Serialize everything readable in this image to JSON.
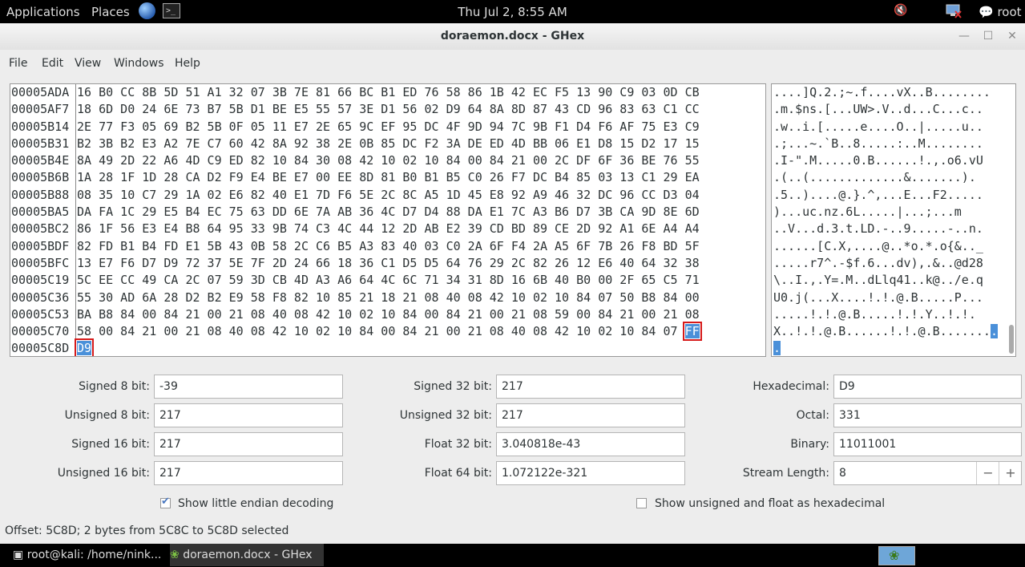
{
  "topbar": {
    "applications": "Applications",
    "places": "Places",
    "clock": "Thu Jul  2,  8:55 AM",
    "user": "root"
  },
  "window": {
    "title": "doraemon.docx - GHex"
  },
  "menu": [
    "File",
    "Edit",
    "View",
    "Windows",
    "Help"
  ],
  "hex": {
    "offsets": [
      "00005ADA",
      "00005AF7",
      "00005B14",
      "00005B31",
      "00005B4E",
      "00005B6B",
      "00005B88",
      "00005BA5",
      "00005BC2",
      "00005BDF",
      "00005BFC",
      "00005C19",
      "00005C36",
      "00005C53",
      "00005C70",
      "00005C8D"
    ],
    "rows": [
      "16 B0 CC 8B 5D 51 A1 32 07 3B 7E 81 66 BC B1 ED 76 58 86 1B 42 EC F5 13 90 C9 03 0D CB",
      "18 6D D0 24 6E 73 B7 5B D1 BE E5 55 57 3E D1 56 02 D9 64 8A 8D 87 43 CD 96 83 63 C1 CC",
      "2E 77 F3 05 69 B2 5B 0F 05 11 E7 2E 65 9C EF 95 DC 4F 9D 94 7C 9B F1 D4 F6 AF 75 E3 C9",
      "B2 3B B2 E3 A2 7E C7 60 42 8A 92 38 2E 0B 85 DC F2 3A DE ED 4D BB 06 E1 D8 15 D2 17 15",
      "8A 49 2D 22 A6 4D C9 ED 82 10 84 30 08 42 10 02 10 84 00 84 21 00 2C DF 6F 36 BE 76 55",
      "1A 28 1F 1D 28 CA D2 F9 E4 BE E7 00 EE 8D 81 B0 B1 B5 C0 26 F7 DC B4 85 03 13 C1 29 EA",
      "08 35 10 C7 29 1A 02 E6 82 40 E1 7D F6 5E 2C 8C A5 1D 45 E8 92 A9 46 32 DC 96 CC D3 04",
      "DA FA 1C 29 E5 B4 EC 75 63 DD 6E 7A AB 36 4C D7 D4 88 DA E1 7C A3 B6 D7 3B CA 9D 8E 6D",
      "86 1F 56 E3 E4 B8 64 95 33 9B 74 C3 4C 44 12 2D AB E2 39 CD BD 89 CE 2D 92 A1 6E A4 A4",
      "82 FD B1 B4 FD E1 5B 43 0B 58 2C C6 B5 A3 83 40 03 C0 2A 6F F4 2A A5 6F 7B 26 F8 BD 5F",
      "13 E7 F6 D7 D9 72 37 5E 7F 2D 24 66 18 36 C1 D5 D5 64 76 29 2C 82 26 12 E6 40 64 32 38",
      "5C EE CC 49 CA 2C 07 59 3D CB 4D A3 A6 64 4C 6C 71 34 31 8D 16 6B 40 B0 00 2F 65 C5 71",
      "55 30 AD 6A 28 D2 B2 E9 58 F8 82 10 85 21 18 21 08 40 08 42 10 02 10 84 07 50 B8 84 00",
      "BA B8 84 00 84 21 00 21 08 40 08 42 10 02 10 84 00 84 21 00 21 08 59 00 84 21 00 21 08",
      "58 00 84 21 00 21 08 40 08 42 10 02 10 84 00 84 21 00 21 08 40 08 42 10 02 10 84 07 ",
      ""
    ],
    "row15_last": "FF",
    "row16_first": "D9",
    "ascii": [
      "....]Q.2.;~.f....vX..B........",
      ".m.$ns.[...UW>.V..d...C...c..",
      ".w..i.[.....e....O..|.....u..",
      ".;...~.`B..8.....:..M........",
      ".I-\".M.....0.B......!.,.o6.vU",
      ".(..(.............&.......).",
      ".5..)....@.}.^,...E...F2.....",
      ")...uc.nz.6L.....|...;...m",
      "..V...d.3.t.LD.-..9.....-..n.",
      "......[C.X,....@..*o.*.o{&.._",
      ".....r7^.-$f.6...dv),.&..@d28",
      "\\..I.,.Y=.M..dLlq41..k@../e.q",
      "U0.j(...X....!.!.@.B.....P...",
      ".....!.!.@.B.....!.!.Y..!.!.",
      "X..!.!.@.B......!.!.@.B.......",
      ""
    ],
    "ascii15_sel": ".",
    "ascii16_sel": "."
  },
  "fields": {
    "signed8": {
      "label": "Signed 8 bit:",
      "value": "-39"
    },
    "unsigned8": {
      "label": "Unsigned 8 bit:",
      "value": "217"
    },
    "signed16": {
      "label": "Signed 16 bit:",
      "value": "217"
    },
    "unsigned16": {
      "label": "Unsigned 16 bit:",
      "value": "217"
    },
    "signed32": {
      "label": "Signed 32 bit:",
      "value": "217"
    },
    "unsigned32": {
      "label": "Unsigned 32 bit:",
      "value": "217"
    },
    "float32": {
      "label": "Float 32 bit:",
      "value": "3.040818e-43"
    },
    "float64": {
      "label": "Float 64 bit:",
      "value": "1.072122e-321"
    },
    "hex": {
      "label": "Hexadecimal:",
      "value": "D9"
    },
    "octal": {
      "label": "Octal:",
      "value": "331"
    },
    "binary": {
      "label": "Binary:",
      "value": "11011001"
    },
    "stream": {
      "label": "Stream Length:",
      "value": "8"
    }
  },
  "options": {
    "little_endian": "Show little endian decoding",
    "unsigned_hex": "Show unsigned and float as hexadecimal"
  },
  "status": "Offset: 5C8D; 2 bytes from 5C8C to 5C8D selected",
  "taskbar": {
    "terminal": "root@kali: /home/nink...",
    "ghex": "doraemon.docx - GHex"
  }
}
